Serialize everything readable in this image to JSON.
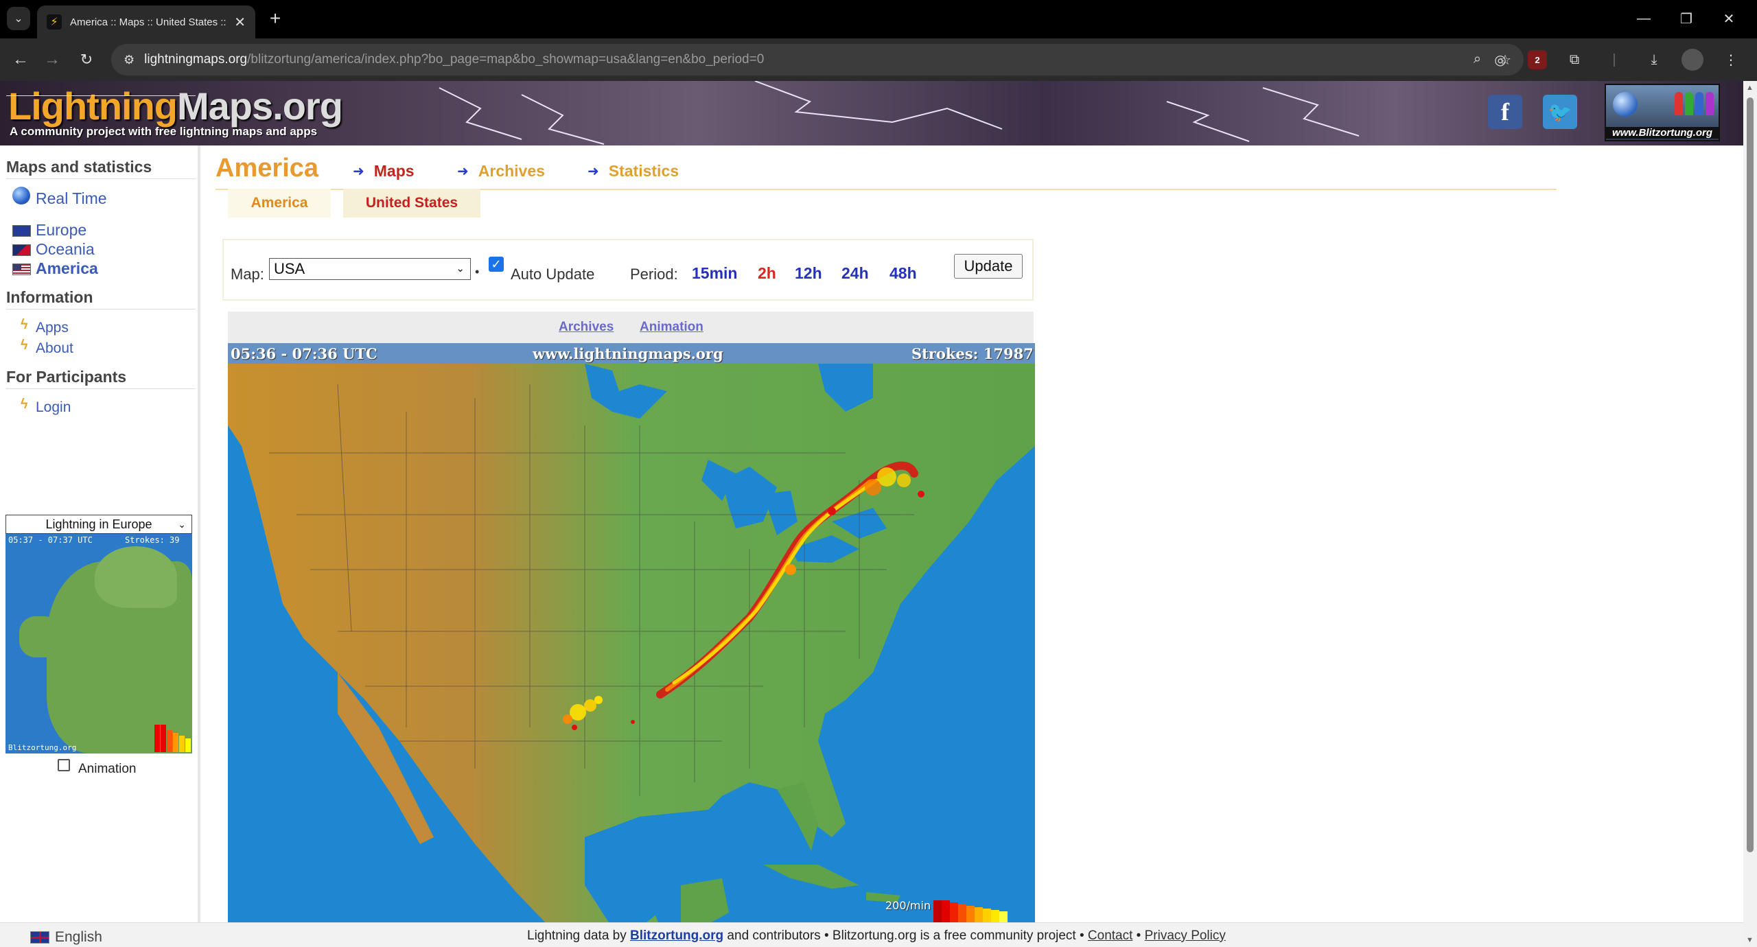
{
  "browser": {
    "tab_title": "America :: Maps :: United States :: L",
    "tab_close": "✕",
    "new_tab": "+",
    "url_host": "lightningmaps.org",
    "url_path": "/blitzortung/america/index.php?bo_page=map&bo_showmap=usa&lang=en&bo_period=0",
    "ublock_count": "2"
  },
  "banner": {
    "logo_part1": "Lightning",
    "logo_part2": "Maps.org",
    "tagline": "A community project with free lightning maps and apps",
    "facebook_glyph": "f",
    "blitzortung_label": "www.Blitzortung.org"
  },
  "sidebar": {
    "heading_maps": "Maps and statistics",
    "real_time": "Real Time",
    "regions": [
      "Europe",
      "Oceania",
      "America"
    ],
    "heading_info": "Information",
    "info_links": [
      "Apps",
      "About"
    ],
    "heading_participants": "For Participants",
    "login": "Login",
    "mini_select": "Lightning in Europe",
    "mini_time": "05:37 - 07:37 UTC",
    "mini_strokes": "Strokes: 39",
    "mini_footer": "Blitzortung.org",
    "animation_label": "Animation"
  },
  "main": {
    "title": "America",
    "nav": [
      "Maps",
      "Archives",
      "Statistics"
    ],
    "subtabs": [
      "America",
      "United States"
    ],
    "map_label": "Map:",
    "map_value": "USA",
    "auto_update_label": "Auto Update",
    "period_label": "Period:",
    "periods": [
      "15min",
      "2h",
      "12h",
      "24h",
      "48h"
    ],
    "active_period": "2h",
    "update_button": "Update",
    "map_links": [
      "Archives",
      "Animation"
    ],
    "map_time": "05:36 - 07:36 UTC",
    "map_site": "www.lightningmaps.org",
    "map_strokes": "Strokes: 17987",
    "legend_rate": "200/min"
  },
  "footer": {
    "language": "English",
    "text_prefix": "Lightning data by ",
    "blitzortung_link": "Blitzortung.org",
    "text_middle": " and contributors • Blitzortung.org is a free community project • ",
    "contact": "Contact",
    "separator": " • ",
    "privacy": "Privacy Policy"
  },
  "colors": {
    "accent_orange": "#e89a30",
    "nav_active_red": "#c0281e",
    "link_blue": "#3a5ab8",
    "ocean": "#1e87d2",
    "land_green": "#6aa84f",
    "strike_red": "#e01010",
    "strike_yellow": "#ffe000"
  }
}
